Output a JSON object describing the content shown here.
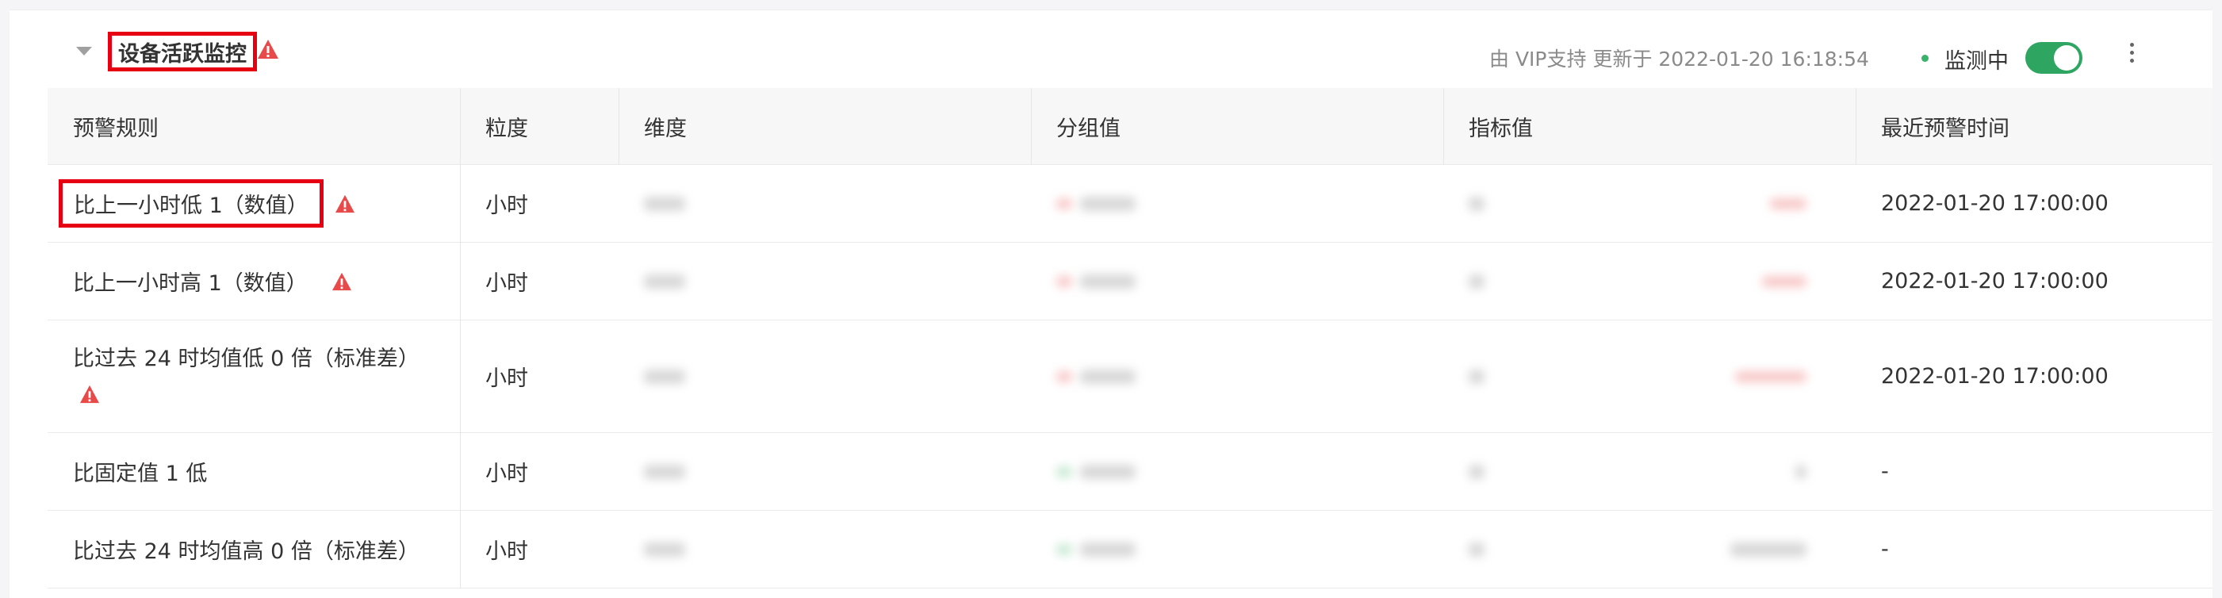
{
  "header": {
    "title": "设备活跃监控",
    "updated_text": "由 VIP支持 更新于 2022-01-20 16:18:54",
    "status_label": "监测中",
    "toggle_on": true
  },
  "table": {
    "columns": [
      "预警规则",
      "粒度",
      "维度",
      "分组值",
      "指标值",
      "最近预警时间"
    ],
    "rows": [
      {
        "rule": "比上一小时低 1（数值）",
        "granularity": "小时",
        "last_alert": "2022-01-20 17:00:00",
        "warning": true,
        "highlighted": true,
        "delta": "down"
      },
      {
        "rule": "比上一小时高 1（数值）",
        "granularity": "小时",
        "last_alert": "2022-01-20 17:00:00",
        "warning": true,
        "highlighted": false,
        "delta": "down"
      },
      {
        "rule": "比过去 24 时均值低 0 倍（标准差）",
        "granularity": "小时",
        "last_alert": "2022-01-20 17:00:00",
        "warning": true,
        "highlighted": false,
        "delta": "down"
      },
      {
        "rule": "比固定值 1 低",
        "granularity": "小时",
        "last_alert": "-",
        "warning": false,
        "highlighted": false,
        "delta": "up"
      },
      {
        "rule": "比过去 24 时均值高 0 倍（标准差）",
        "granularity": "小时",
        "last_alert": "-",
        "warning": false,
        "highlighted": false,
        "delta": "up"
      }
    ]
  },
  "colors": {
    "highlight_box": "#e60012",
    "warning_icon": "#e84a4a",
    "toggle_on": "#2fa562",
    "status_dot": "#39b36b"
  },
  "icons": {
    "collapse": "caret-down-icon",
    "warning": "warning-triangle-icon",
    "more": "more-vertical-icon"
  }
}
